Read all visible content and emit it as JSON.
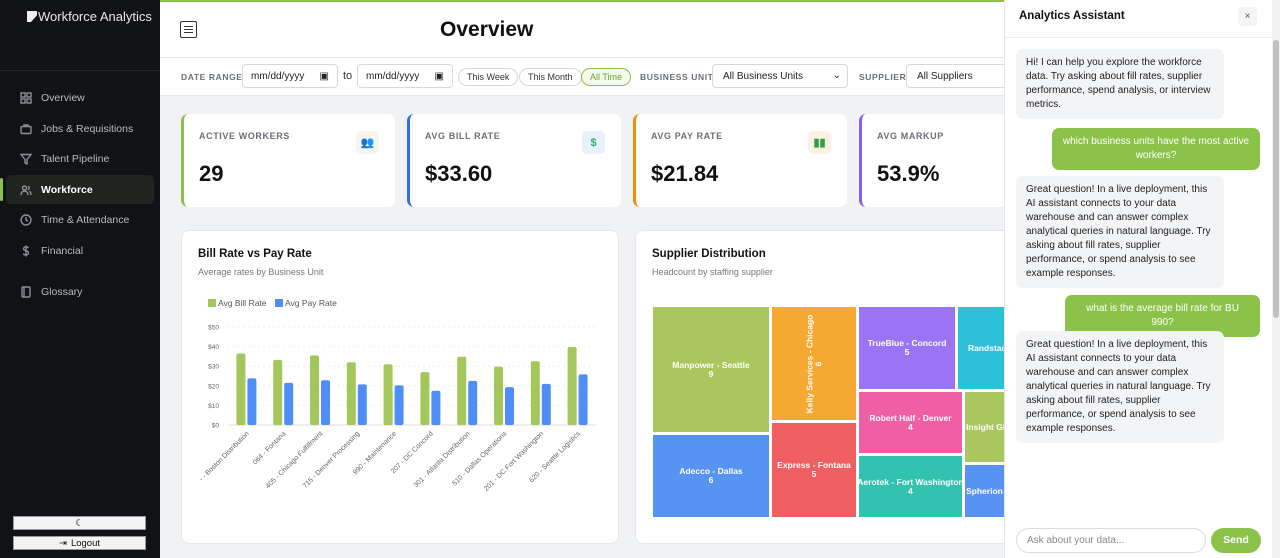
{
  "app": {
    "title": "Workforce Analytics"
  },
  "sidebar": {
    "items": [
      {
        "label": "Overview",
        "icon": "grid-icon"
      },
      {
        "label": "Jobs & Requisitions",
        "icon": "briefcase-icon"
      },
      {
        "label": "Talent Pipeline",
        "icon": "filter-icon"
      },
      {
        "label": "Workforce",
        "icon": "users-icon",
        "active": true
      },
      {
        "label": "Time & Attendance",
        "icon": "clock-icon"
      },
      {
        "label": "Financial",
        "icon": "dollar-icon"
      },
      {
        "label": "Glossary",
        "icon": "book-icon"
      }
    ],
    "theme_toggle": "☾",
    "logout": "Logout"
  },
  "header": {
    "title": "Overview"
  },
  "filters": {
    "date_range_label": "DATE RANGE",
    "date_from": "mm/dd/yyyy",
    "to": "to",
    "date_to": "mm/dd/yyyy",
    "presets": [
      "This Week",
      "This Month",
      "All Time"
    ],
    "active_preset": "All Time",
    "business_unit_label": "BUSINESS UNIT",
    "business_unit": "All Business Units",
    "supplier_label": "SUPPLIER",
    "supplier": "All Suppliers"
  },
  "kpis": [
    {
      "label": "ACTIVE WORKERS",
      "value": "29",
      "color": "#8bc34a",
      "icon": "users-icon"
    },
    {
      "label": "AVG BILL RATE",
      "value": "$33.60",
      "color": "#2f6fe4",
      "icon": "dollar-icon"
    },
    {
      "label": "AVG PAY RATE",
      "value": "$21.84",
      "color": "#f08c00",
      "icon": "cash-icon"
    },
    {
      "label": "AVG MARKUP",
      "value": "53.9%",
      "color": "#8b5cf6"
    }
  ],
  "chart_data": [
    {
      "type": "bar",
      "title": "Bill Rate vs Pay Rate",
      "subtitle": "Average rates by Business Unit",
      "categories": [
        "- - Boston Distribution",
        "064 - Fontana",
        "405 - Chicago Fulfillment",
        "715 - Denver Processing",
        "990 - Maintenance",
        "207 - DC Concord",
        "301 - Atlanta Distribution",
        "510 - Dallas Operations",
        "201 - DC Fort Washington",
        "620 - Seattle Logistics"
      ],
      "series": [
        {
          "name": "Avg Bill Rate",
          "color": "#a3c75a",
          "values": [
            36.5,
            33.2,
            35.5,
            32,
            31,
            27,
            34.8,
            29.8,
            32.5,
            39.8
          ]
        },
        {
          "name": "Avg Pay Rate",
          "color": "#4f8ef7",
          "values": [
            23.8,
            21.5,
            22.8,
            20.7,
            20.2,
            17.5,
            22.5,
            19.3,
            21,
            25.8
          ]
        }
      ],
      "yticks": [
        "$0",
        "$10",
        "$20",
        "$30",
        "$40",
        "$50"
      ],
      "ylim": [
        0,
        50
      ],
      "legend": "top-left",
      "grid": true
    },
    {
      "type": "treemap",
      "title": "Supplier Distribution",
      "subtitle": "Headcount by staffing supplier",
      "tiles": [
        {
          "name": "Manpower - Seattle",
          "value": "9",
          "color": "#a9c75c"
        },
        {
          "name": "Adecco - Dallas",
          "value": "6",
          "color": "#5794f2"
        },
        {
          "name": "Kelly Services - Chicago",
          "value": "6",
          "color": "#f5a832"
        },
        {
          "name": "Express - Fontana",
          "value": "5",
          "color": "#ef5f61"
        },
        {
          "name": "TrueBlue - Concord",
          "value": "5",
          "color": "#9b74f4"
        },
        {
          "name": "Randstad",
          "value": "",
          "color": "#2cc0d9"
        },
        {
          "name": "Robert Half - Denver",
          "value": "4",
          "color": "#ee5fa3"
        },
        {
          "name": "Aerotek - Fort Washington",
          "value": "4",
          "color": "#33c2b0"
        },
        {
          "name": "Insight Gl",
          "value": "",
          "color": "#a9c75c"
        },
        {
          "name": "Spherion -",
          "value": "",
          "color": "#5794f2"
        }
      ]
    }
  ],
  "chat": {
    "title": "Analytics Assistant",
    "close": "×",
    "messages": [
      {
        "role": "bot",
        "text": "Hi! I can help you explore the workforce data. Try asking about fill rates, supplier performance, spend analysis, or interview metrics."
      },
      {
        "role": "user",
        "text": "which business units have the most active workers?"
      },
      {
        "role": "bot",
        "text": "Great question! In a live deployment, this AI assistant connects to your data warehouse and can answer complex analytical queries in natural language. Try asking about fill rates, supplier performance, or spend analysis to see example responses."
      },
      {
        "role": "user",
        "text": "what is the average bill rate for BU 990?"
      },
      {
        "role": "bot",
        "text": "Great question! In a live deployment, this AI assistant connects to your data warehouse and can answer complex analytical queries in natural language. Try asking about fill rates, supplier performance, or spend analysis to see example responses."
      }
    ],
    "placeholder": "Ask about your data...",
    "send": "Send"
  }
}
